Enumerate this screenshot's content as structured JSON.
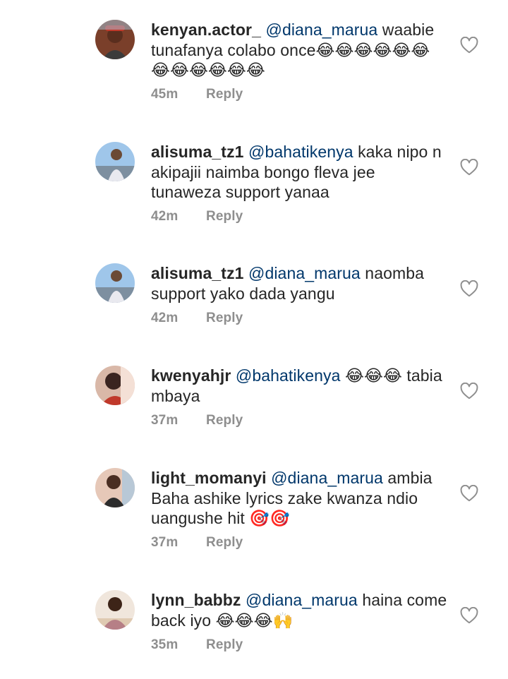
{
  "comments": [
    {
      "username": "kenyan.actor_",
      "mention": "@diana_marua",
      "text": " waabie tunafanya colabo once😂😂😂😂😂😂😂😂😂😂😂😂",
      "time": "45m",
      "reply_label": "Reply"
    },
    {
      "username": "alisuma_tz1",
      "mention": "@bahatikenya",
      "text": " kaka nipo n akipajii naimba bongo fleva jee tunaweza support yanaa",
      "time": "42m",
      "reply_label": "Reply"
    },
    {
      "username": "alisuma_tz1",
      "mention": "@diana_marua",
      "text": " naomba support yako dada yangu",
      "time": "42m",
      "reply_label": "Reply"
    },
    {
      "username": "kwenyahjr",
      "mention": "@bahatikenya",
      "text": " 😂😂😂 tabia mbaya",
      "time": "37m",
      "reply_label": "Reply"
    },
    {
      "username": "light_momanyi",
      "mention": "@diana_marua",
      "text": " ambia Baha ashike lyrics zake kwanza ndio uangushe hit 🎯🎯",
      "time": "37m",
      "reply_label": "Reply"
    },
    {
      "username": "lynn_babbz",
      "mention": "@diana_marua",
      "text": " haina come back iyo 😂😂😂🙌",
      "time": "35m",
      "reply_label": "Reply"
    }
  ],
  "icons": {
    "like": "heart-outline-icon"
  },
  "colors": {
    "mention": "#00376b",
    "meta": "#8e8e8e",
    "username": "#262626"
  }
}
